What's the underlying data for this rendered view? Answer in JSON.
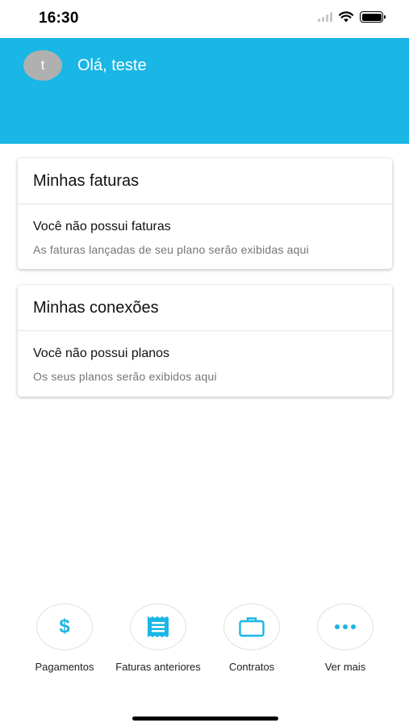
{
  "status_bar": {
    "time": "16:30"
  },
  "header": {
    "avatar_initial": "t",
    "greeting": "Olá, teste",
    "background_color": "#19b6e6"
  },
  "cards": [
    {
      "title": "Minhas faturas",
      "main_text": "Você não possui faturas",
      "sub_text": "As faturas lançadas de seu plano serão exibidas aqui"
    },
    {
      "title": "Minhas conexões",
      "main_text": "Você não possui planos",
      "sub_text": "Os seus planos serão exibidos aqui"
    }
  ],
  "bottom_nav": {
    "accent_color": "#19b6e6",
    "items": [
      {
        "label": "Pagamentos",
        "icon": "dollar-icon"
      },
      {
        "label": "Faturas anteriores",
        "icon": "receipt-icon"
      },
      {
        "label": "Contratos",
        "icon": "briefcase-icon"
      },
      {
        "label": "Ver mais",
        "icon": "more-icon"
      }
    ]
  }
}
